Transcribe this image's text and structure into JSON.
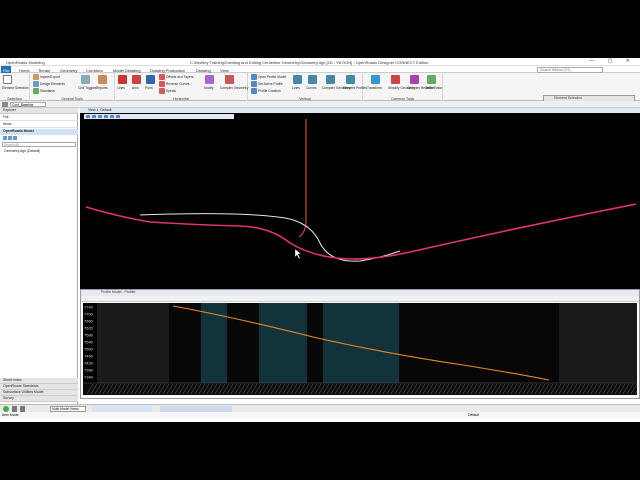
{
  "window": {
    "workflow": "OpenRoads Modeling",
    "title": "C:\\Bentley Training\\Creating and Editing Centerline Geometry\\Geometry.dgn [2D - V8 DGN] - OpenRoads Designer CONNECT Edition",
    "controls": "— ▢ ✕"
  },
  "menu": {
    "items": [
      "File",
      "Home",
      "Terrain",
      "Geometry",
      "Corridors",
      "Model Detailing",
      "Drawing Production",
      "Drawing",
      "View"
    ],
    "active": "File"
  },
  "search": {
    "placeholder": "Search Ribbon (F4)"
  },
  "ribbon": {
    "groups": [
      {
        "label": "Selection",
        "buttons": [
          "Element Selection"
        ]
      },
      {
        "label": "General Tools",
        "buttons": [
          "Import/Export",
          "Design Elements",
          "Standards",
          "Civil Toggles",
          "Reports"
        ]
      },
      {
        "label": "Horizontal",
        "buttons": [
          "Lines",
          "Arcs",
          "Point",
          "Offsets and Tapers",
          "Reverse Curves",
          "Spirals",
          "Modify",
          "Complex Geometry"
        ]
      },
      {
        "label": "Vertical",
        "buttons": [
          "Open Profile Model",
          "Set Active Profile",
          "Profile Creation",
          "Lines",
          "Curves",
          "Complex Geometry",
          "Element Profiles"
        ]
      },
      {
        "label": "Common Tools",
        "buttons": [
          "Transform",
          "Simplify Geometry",
          "Complex Redefine",
          "Table Editor"
        ]
      }
    ]
  },
  "leftpanel": {
    "items": [
      "Explorer",
      "File",
      "Items",
      "OpenRoads Model",
      "Geometry.dgn (Default)"
    ],
    "dropdown": "Cont_Baseline",
    "search_placeholder": "Search All",
    "bottom_items": [
      "Sheet Index",
      "OpenRoads Standards",
      "Subsurface Utilities Model",
      "Survey"
    ]
  },
  "view1": {
    "title": "View 1, Default"
  },
  "profile_view": {
    "title": "Profile Model - Profiler",
    "y_ticks": [
      "7740",
      "7700",
      "7660",
      "7620",
      "7580",
      "7540",
      "7500",
      "7460",
      "7420",
      "7380",
      "7340"
    ]
  },
  "status": {
    "view_mode": "Multi-Model Views",
    "default_label": "Default",
    "left_text": "Item Mode"
  },
  "element_selection": {
    "title": "Element Selection"
  },
  "colors": {
    "alignment": "#e0307a",
    "tangent": "#d94040",
    "profile": "#e8892a",
    "highlight_band": "#13333a"
  }
}
